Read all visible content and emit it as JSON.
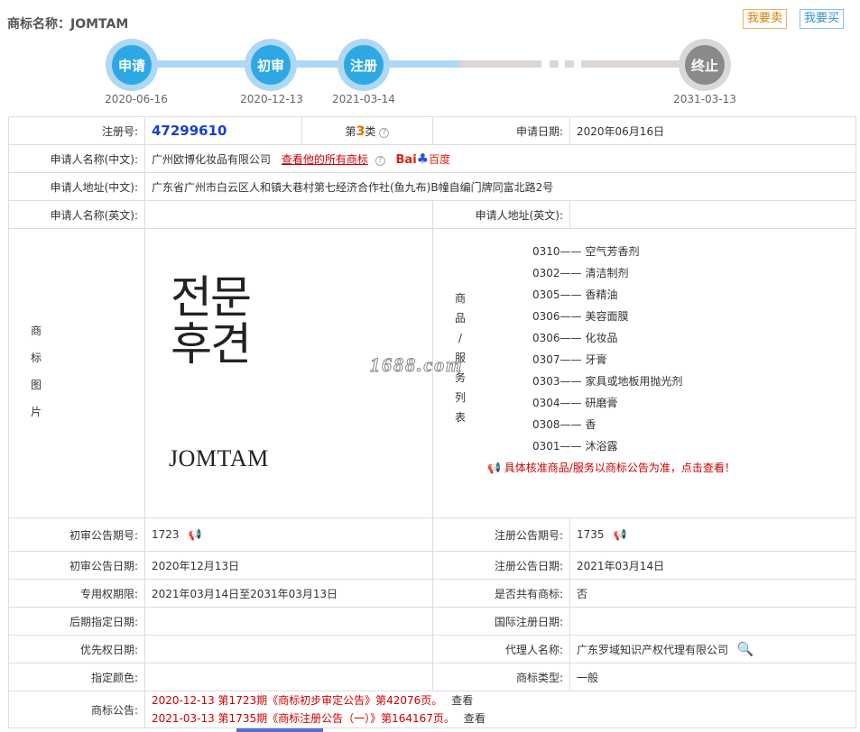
{
  "header": {
    "title_label": "商标名称：",
    "title_value": "JOMTAM",
    "sell_button": "我要卖",
    "buy_button": "我要买"
  },
  "timeline": [
    {
      "label": "申请",
      "date": "2020-06-16",
      "state": "done"
    },
    {
      "label": "初审",
      "date": "2020-12-13",
      "state": "done"
    },
    {
      "label": "注册",
      "date": "2021-03-14",
      "state": "done"
    },
    {
      "label": "终止",
      "date": "2031-03-13",
      "state": "future"
    }
  ],
  "info": {
    "reg_no_label": "注册号:",
    "reg_no": "47299610",
    "class_prefix": "第",
    "class_num": "3",
    "class_suffix": "类",
    "apply_date_label": "申请日期:",
    "apply_date": "2020年06月16日",
    "applicant_cn_label": "申请人名称(中文):",
    "applicant_cn": "广州欧博化妆品有限公司",
    "all_marks_link": "查看他的所有商标",
    "baidu_label": "Bai",
    "baidu_cn": "百度",
    "address_cn_label": "申请人地址(中文):",
    "address_cn": "广东省广州市白云区人和镇大巷村第七经济合作社(鱼九布)B幢自编门牌同富北路2号",
    "applicant_en_label": "申请人名称(英文):",
    "applicant_en": "",
    "address_en_label": "申请人地址(英文):",
    "address_en": "",
    "logo_label_chars": [
      "商",
      "标",
      "图",
      "片"
    ],
    "logo_korean_line1": "전문",
    "logo_korean_line2": "후견",
    "logo_text": "JOMTAM",
    "watermark": "1688.com",
    "goods_label_chars": [
      "商",
      "品",
      "/",
      "服",
      "务",
      "列",
      "表"
    ],
    "goods": [
      {
        "code": "0310",
        "name": "空气芳香剂"
      },
      {
        "code": "0302",
        "name": "清洁制剂"
      },
      {
        "code": "0305",
        "name": "香精油"
      },
      {
        "code": "0306",
        "name": "美容面膜"
      },
      {
        "code": "0306",
        "name": "化妆品"
      },
      {
        "code": "0307",
        "name": "牙膏"
      },
      {
        "code": "0303",
        "name": "家具或地板用抛光剂"
      },
      {
        "code": "0304",
        "name": "研磨膏"
      },
      {
        "code": "0308",
        "name": "香"
      },
      {
        "code": "0301",
        "name": "沐浴露"
      }
    ],
    "goods_dash": "——",
    "goods_notice": "具体核准商品/服务以商标公告为准，点击查看！",
    "prelim_no_label": "初审公告期号:",
    "prelim_no": "1723",
    "reg_pub_no_label": "注册公告期号:",
    "reg_pub_no": "1735",
    "prelim_date_label": "初审公告日期:",
    "prelim_date": "2020年12月13日",
    "reg_pub_date_label": "注册公告日期:",
    "reg_pub_date": "2021年03月14日",
    "exclusive_label": "专用权期限:",
    "exclusive": "2021年03月14日至2031年03月13日",
    "shared_label": "是否共有商标:",
    "shared": "否",
    "later_date_label": "后期指定日期:",
    "later_date": "",
    "intl_date_label": "国际注册日期:",
    "intl_date": "",
    "priority_label": "优先权日期:",
    "priority": "",
    "agent_label": "代理人名称:",
    "agent": "广东罗域知识产权代理有限公司",
    "color_label": "指定颜色:",
    "color": "",
    "type_label": "商标类型:",
    "type": "一般",
    "announce_label": "商标公告:",
    "announcements": [
      {
        "text": "2020-12-13 第1723期《商标初步审定公告》第42076页。",
        "view": "查看"
      },
      {
        "text": "2021-03-13 第1735期《商标注册公告（一）》第164167页。",
        "view": "查看"
      }
    ]
  },
  "colors": {
    "accent_blue": "#2ea8e5",
    "link_red": "#cc0000",
    "regno_blue": "#1a3fd6"
  }
}
